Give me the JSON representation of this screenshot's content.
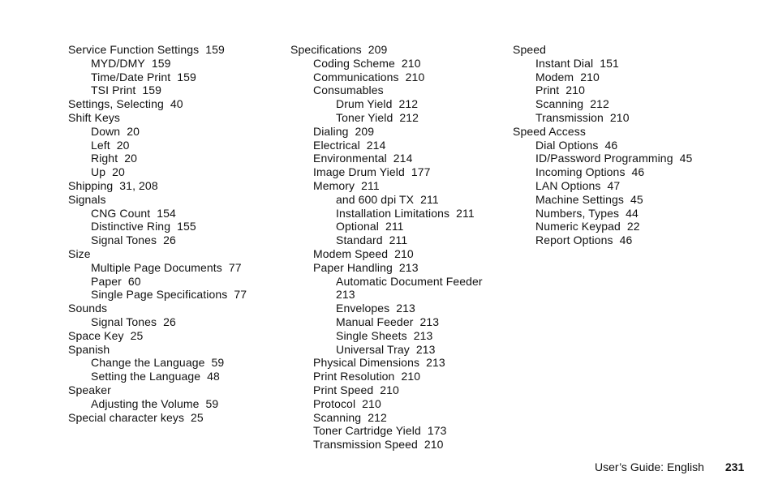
{
  "index": {
    "columns": [
      [
        {
          "level": 0,
          "term": "Service Function Settings",
          "pages": "159"
        },
        {
          "level": 1,
          "term": "MYD/DMY",
          "pages": "159"
        },
        {
          "level": 1,
          "term": "Time/Date Print",
          "pages": "159"
        },
        {
          "level": 1,
          "term": "TSI Print",
          "pages": "159"
        },
        {
          "level": 0,
          "term": "Settings, Selecting",
          "pages": "40"
        },
        {
          "level": 0,
          "term": "Shift Keys",
          "pages": ""
        },
        {
          "level": 1,
          "term": "Down",
          "pages": "20"
        },
        {
          "level": 1,
          "term": "Left",
          "pages": "20"
        },
        {
          "level": 1,
          "term": "Right",
          "pages": "20"
        },
        {
          "level": 1,
          "term": "Up",
          "pages": "20"
        },
        {
          "level": 0,
          "term": "Shipping",
          "pages": "31,  208"
        },
        {
          "level": 0,
          "term": "Signals",
          "pages": ""
        },
        {
          "level": 1,
          "term": "CNG Count",
          "pages": "154"
        },
        {
          "level": 1,
          "term": "Distinctive Ring",
          "pages": "155"
        },
        {
          "level": 1,
          "term": "Signal Tones",
          "pages": "26"
        },
        {
          "level": 0,
          "term": "Size",
          "pages": ""
        },
        {
          "level": 1,
          "term": "Multiple Page Documents",
          "pages": "77"
        },
        {
          "level": 1,
          "term": "Paper",
          "pages": "60"
        },
        {
          "level": 1,
          "term": "Single Page Specifications",
          "pages": "77"
        },
        {
          "level": 0,
          "term": "Sounds",
          "pages": ""
        },
        {
          "level": 1,
          "term": "Signal Tones",
          "pages": "26"
        },
        {
          "level": 0,
          "term": "Space Key",
          "pages": "25"
        },
        {
          "level": 0,
          "term": "Spanish",
          "pages": ""
        },
        {
          "level": 1,
          "term": "Change the Language",
          "pages": "59"
        },
        {
          "level": 1,
          "term": "Setting the Language",
          "pages": "48"
        },
        {
          "level": 0,
          "term": "Speaker",
          "pages": ""
        },
        {
          "level": 1,
          "term": "Adjusting the Volume",
          "pages": "59"
        },
        {
          "level": 0,
          "term": "Special character keys",
          "pages": "25"
        }
      ],
      [
        {
          "level": 0,
          "term": "Specifications",
          "pages": "209"
        },
        {
          "level": 1,
          "term": "Coding Scheme",
          "pages": "210"
        },
        {
          "level": 1,
          "term": "Communications",
          "pages": "210"
        },
        {
          "level": 1,
          "term": "Consumables",
          "pages": ""
        },
        {
          "level": 2,
          "term": "Drum Yield",
          "pages": "212"
        },
        {
          "level": 2,
          "term": "Toner Yield",
          "pages": "212"
        },
        {
          "level": 1,
          "term": "Dialing",
          "pages": "209"
        },
        {
          "level": 1,
          "term": "Electrical",
          "pages": "214"
        },
        {
          "level": 1,
          "term": "Environmental",
          "pages": "214"
        },
        {
          "level": 1,
          "term": "Image Drum Yield",
          "pages": "177"
        },
        {
          "level": 1,
          "term": "Memory",
          "pages": "211"
        },
        {
          "level": 2,
          "term": "and 600 dpi TX",
          "pages": "211"
        },
        {
          "level": 2,
          "term": "Installation Limitations",
          "pages": "211"
        },
        {
          "level": 2,
          "term": "Optional",
          "pages": "211"
        },
        {
          "level": 2,
          "term": "Standard",
          "pages": "211"
        },
        {
          "level": 1,
          "term": "Modem Speed",
          "pages": "210"
        },
        {
          "level": 1,
          "term": "Paper Handling",
          "pages": "213"
        },
        {
          "level": 2,
          "term": "Automatic Document Feeder",
          "pages": ""
        },
        {
          "level": 2,
          "term": "213",
          "pages": ""
        },
        {
          "level": 2,
          "term": "Envelopes",
          "pages": "213"
        },
        {
          "level": 2,
          "term": "Manual Feeder",
          "pages": "213"
        },
        {
          "level": 2,
          "term": "Single Sheets",
          "pages": "213"
        },
        {
          "level": 2,
          "term": "Universal Tray",
          "pages": "213"
        },
        {
          "level": 1,
          "term": "Physical Dimensions",
          "pages": "213"
        },
        {
          "level": 1,
          "term": "Print Resolution",
          "pages": "210"
        },
        {
          "level": 1,
          "term": "Print Speed",
          "pages": "210"
        },
        {
          "level": 1,
          "term": "Protocol",
          "pages": "210"
        },
        {
          "level": 1,
          "term": "Scanning",
          "pages": "212"
        },
        {
          "level": 1,
          "term": "Toner Cartridge Yield",
          "pages": "173"
        },
        {
          "level": 1,
          "term": "Transmission Speed",
          "pages": "210"
        }
      ],
      [
        {
          "level": 0,
          "term": "Speed",
          "pages": ""
        },
        {
          "level": 1,
          "term": "Instant Dial",
          "pages": "151"
        },
        {
          "level": 1,
          "term": "Modem",
          "pages": "210"
        },
        {
          "level": 1,
          "term": "Print",
          "pages": "210"
        },
        {
          "level": 1,
          "term": "Scanning",
          "pages": "212"
        },
        {
          "level": 1,
          "term": "Transmission",
          "pages": "210"
        },
        {
          "level": 0,
          "term": "Speed Access",
          "pages": ""
        },
        {
          "level": 1,
          "term": "Dial Options",
          "pages": "46"
        },
        {
          "level": 1,
          "term": "ID/Password Programming",
          "pages": "45"
        },
        {
          "level": 1,
          "term": "Incoming Options",
          "pages": "46"
        },
        {
          "level": 1,
          "term": "LAN Options",
          "pages": "47"
        },
        {
          "level": 1,
          "term": "Machine Settings",
          "pages": "45"
        },
        {
          "level": 1,
          "term": "Numbers, Types",
          "pages": "44"
        },
        {
          "level": 1,
          "term": "Numeric Keypad",
          "pages": "22"
        },
        {
          "level": 1,
          "term": "Report Options",
          "pages": "46"
        }
      ]
    ]
  },
  "footer": {
    "title": "User’s Guide:  English",
    "page_number": "231"
  }
}
